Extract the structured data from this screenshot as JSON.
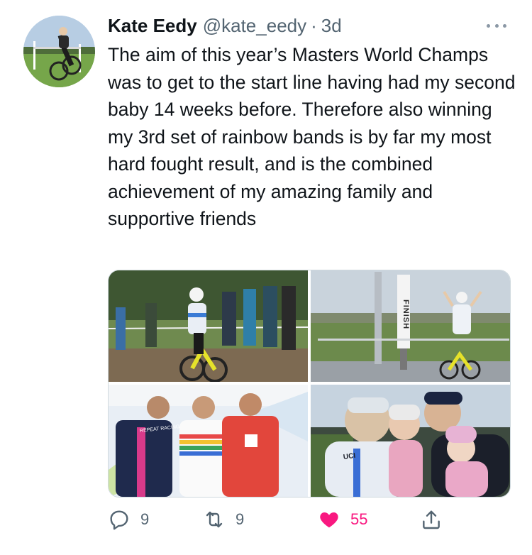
{
  "tweet": {
    "display_name": "Kate Eedy",
    "handle": "@kate_eedy",
    "separator": "·",
    "timestamp": "3d",
    "text": "The aim of this year’s Masters World Champs was to get to the start line having had my second baby 14 weeks before. Therefore also winning my 3rd set of rainbow bands is by far my most hard fought result, and is the combined achievement of my amazing family and supportive friends"
  },
  "media": {
    "photo_1_banner": "",
    "photo_2_banner": "FINISH",
    "photo_3_jersey": "REPEAT RACING",
    "photo_4_jersey": "UCI"
  },
  "actions": {
    "reply_count": "9",
    "retweet_count": "9",
    "like_count": "55",
    "liked": true
  },
  "colors": {
    "text": "#0f1419",
    "muted": "#536471",
    "like": "#f91880",
    "border": "#cfd9de"
  },
  "icons": {
    "more": "more-horizontal-icon",
    "reply": "reply-icon",
    "retweet": "retweet-icon",
    "like": "heart-filled-icon",
    "share": "share-icon"
  }
}
